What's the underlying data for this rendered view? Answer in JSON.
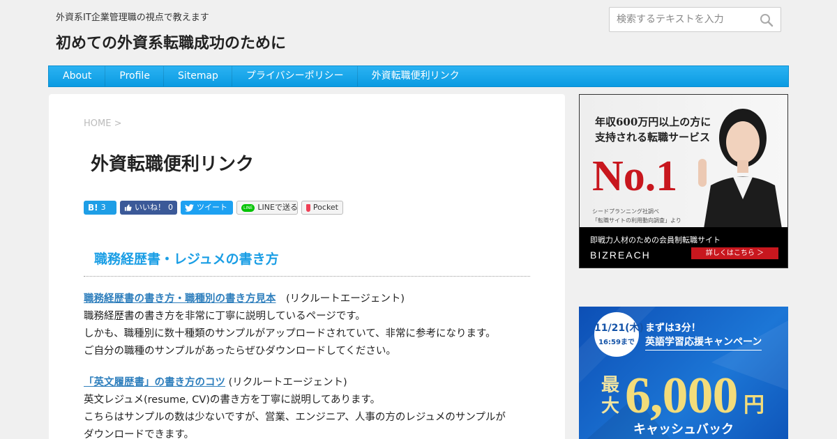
{
  "header": {
    "tagline": "外資系IT企業管理職の視点で教えます",
    "site_title": "初めての外資系転職成功のために"
  },
  "search": {
    "placeholder": "検索するテキストを入力"
  },
  "nav": {
    "items": [
      "About",
      "Profile",
      "Sitemap",
      "プライバシーポリシー",
      "外資転職便利リンク"
    ]
  },
  "breadcrumb": "HOME >",
  "page_title": "外資転職便利リンク",
  "share": {
    "hatena_icon": "B!",
    "hatena_count": "3",
    "facebook_label": "いいね！",
    "facebook_count": "0",
    "twitter_label": "ツイート",
    "line_badge": "LINE",
    "line_label": "LINEで送る",
    "pocket_label": "Pocket"
  },
  "section_heading": "職務経歴書・レジュメの書き方",
  "entries": [
    {
      "link": "職務経歴書の書き方・職種別の書き方見本",
      "source": "　(リクルートエージェント)",
      "lines": [
        "職務経歴書の書き方を非常に丁寧に説明しているページです。",
        "しかも、職種別に数十種類のサンプルがアップロードされていて、非常に参考になります。",
        "ご自分の職種のサンプルがあったらぜひダウンロードしてください。"
      ]
    },
    {
      "link": "「英文履歴書」の書き方のコツ",
      "source": " (リクルートエージェント)",
      "lines": [
        "英文レジュメ(resume, CV)の書き方を丁寧に説明してあります。",
        "こちらはサンプルの数は少ないですが、営業、エンジニア、人事の方のレジュメのサンプルが",
        "ダウンロードできます。"
      ]
    }
  ],
  "ad_bizreach": {
    "line1": "年収600万円以上の方に",
    "line2": "支持される転職サービス",
    "rank": "No.1",
    "note1": "シードプランニング社調べ",
    "note2": "「転職サイトの利用動向調査」より",
    "tagline": "即戦力人材のための会員制転職サイト",
    "brand": "BIZREACH",
    "cta": "詳しくはこちら ＞"
  },
  "ad_english": {
    "date": "11/21(木)",
    "time": "16:59まで",
    "headline1": "まずは3分！",
    "headline2": "英語学習応援キャンペーン",
    "prefix": "最大",
    "amount": "6,000",
    "unit": "円",
    "ribbon": "キャッシュバック"
  },
  "colors": {
    "nav": "#0a9be2",
    "heading": "#1a9ee5",
    "link": "#2f7fbd",
    "accent_red": "#c8171e"
  }
}
